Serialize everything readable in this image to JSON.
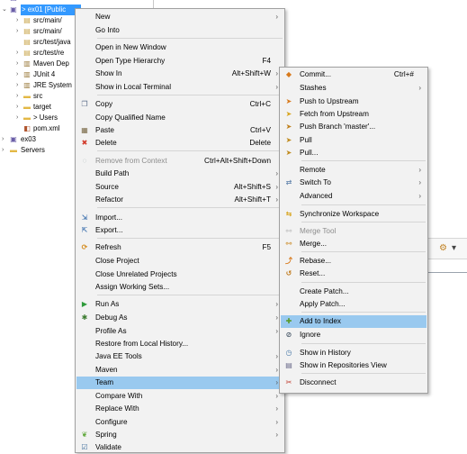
{
  "explorer": {
    "rows": [
      {
        "chevron": "",
        "label": "ex00",
        "icon": "project-icon"
      },
      {
        "chevron": "v",
        "label": "> ex01 [Public ",
        "icon": "project-icon",
        "selected": true
      },
      {
        "chevron": ">",
        "label": "src/main/",
        "icon": "source-folder-icon"
      },
      {
        "chevron": ">",
        "label": "src/main/",
        "icon": "source-folder-icon"
      },
      {
        "chevron": "",
        "label": "src/test/java",
        "icon": "source-folder-icon"
      },
      {
        "chevron": ">",
        "label": "src/test/re",
        "icon": "source-folder-icon"
      },
      {
        "chevron": ">",
        "label": "Maven Dep",
        "icon": "library-icon"
      },
      {
        "chevron": ">",
        "label": "JUnit 4",
        "icon": "library-icon"
      },
      {
        "chevron": ">",
        "label": "JRE System",
        "icon": "library-icon"
      },
      {
        "chevron": ">",
        "label": "src",
        "icon": "folder-icon"
      },
      {
        "chevron": ">",
        "label": "target",
        "icon": "folder-icon"
      },
      {
        "chevron": ">",
        "label": "> Users",
        "icon": "folder-icon"
      },
      {
        "chevron": "",
        "label": "pom.xml",
        "icon": "xml-file-icon"
      },
      {
        "chevron": ">",
        "label": "ex03",
        "icon": "project-icon"
      },
      {
        "chevron": ">",
        "label": "Servers",
        "icon": "folder-icon"
      }
    ]
  },
  "context_menu": {
    "items": [
      {
        "label": "New",
        "submenu": true
      },
      {
        "label": "Go Into"
      },
      {
        "sep": true
      },
      {
        "label": "Open in New Window"
      },
      {
        "label": "Open Type Hierarchy",
        "accel": "F4"
      },
      {
        "label": "Show In",
        "accel": "Alt+Shift+W",
        "submenu": true
      },
      {
        "label": "Show in Local Terminal",
        "submenu": true
      },
      {
        "sep": true
      },
      {
        "label": "Copy",
        "accel": "Ctrl+C",
        "icon": "copy-icon"
      },
      {
        "label": "Copy Qualified Name"
      },
      {
        "label": "Paste",
        "accel": "Ctrl+V",
        "icon": "paste-icon"
      },
      {
        "label": "Delete",
        "accel": "Delete",
        "icon": "delete-icon"
      },
      {
        "sep": true
      },
      {
        "label": "Remove from Context",
        "accel": "Ctrl+Alt+Shift+Down",
        "disabled": true,
        "icon": "remove-context-icon"
      },
      {
        "label": "Build Path",
        "submenu": true
      },
      {
        "label": "Source",
        "accel": "Alt+Shift+S",
        "submenu": true
      },
      {
        "label": "Refactor",
        "accel": "Alt+Shift+T",
        "submenu": true
      },
      {
        "sep": true
      },
      {
        "label": "Import...",
        "icon": "import-icon"
      },
      {
        "label": "Export...",
        "icon": "export-icon"
      },
      {
        "sep": true
      },
      {
        "label": "Refresh",
        "accel": "F5",
        "icon": "refresh-icon"
      },
      {
        "label": "Close Project"
      },
      {
        "label": "Close Unrelated Projects"
      },
      {
        "label": "Assign Working Sets..."
      },
      {
        "sep": true
      },
      {
        "label": "Run As",
        "submenu": true,
        "icon": "run-icon"
      },
      {
        "label": "Debug As",
        "submenu": true,
        "icon": "debug-icon"
      },
      {
        "label": "Profile As",
        "submenu": true
      },
      {
        "label": "Restore from Local History..."
      },
      {
        "label": "Java EE Tools",
        "submenu": true
      },
      {
        "label": "Maven",
        "submenu": true
      },
      {
        "label": "Team",
        "submenu": true,
        "highlight": true
      },
      {
        "label": "Compare With",
        "submenu": true
      },
      {
        "label": "Replace With",
        "submenu": true
      },
      {
        "label": "Configure",
        "submenu": true
      },
      {
        "label": "Spring",
        "submenu": true,
        "icon": "spring-icon"
      },
      {
        "label": "Validate",
        "icon": "validate-icon"
      }
    ]
  },
  "team_menu": {
    "items": [
      {
        "label": "Commit...",
        "accel": "Ctrl+#",
        "icon": "commit-icon"
      },
      {
        "label": "Stashes",
        "submenu": true
      },
      {
        "label": "Push to Upstream",
        "icon": "push-icon"
      },
      {
        "label": "Fetch from Upstream",
        "icon": "fetch-icon"
      },
      {
        "label": "Push Branch 'master'...",
        "icon": "push-branch-icon"
      },
      {
        "label": "Pull",
        "icon": "pull-icon"
      },
      {
        "label": "Pull...",
        "icon": "pull-icon"
      },
      {
        "sep": true
      },
      {
        "label": "Remote",
        "submenu": true
      },
      {
        "label": "Switch To",
        "submenu": true,
        "icon": "switch-icon"
      },
      {
        "label": "Advanced",
        "submenu": true
      },
      {
        "sep": true
      },
      {
        "label": "Synchronize Workspace",
        "icon": "synchronize-icon"
      },
      {
        "sep": true
      },
      {
        "label": "Merge Tool",
        "disabled": true,
        "icon": "merge-tool-icon"
      },
      {
        "label": "Merge...",
        "icon": "merge-icon"
      },
      {
        "sep": true
      },
      {
        "label": "Rebase...",
        "icon": "rebase-icon"
      },
      {
        "label": "Reset...",
        "icon": "reset-icon"
      },
      {
        "sep": true
      },
      {
        "label": "Create Patch..."
      },
      {
        "label": "Apply Patch..."
      },
      {
        "sep": true
      },
      {
        "label": "Add to Index",
        "highlight": true,
        "icon": "add-index-icon"
      },
      {
        "label": "Ignore",
        "icon": "ignore-icon"
      },
      {
        "sep": true
      },
      {
        "label": "Show in History",
        "icon": "history-icon"
      },
      {
        "label": "Show in Repositories View",
        "icon": "repositories-icon"
      },
      {
        "sep": true
      },
      {
        "label": "Disconnect",
        "icon": "disconnect-icon"
      }
    ]
  }
}
